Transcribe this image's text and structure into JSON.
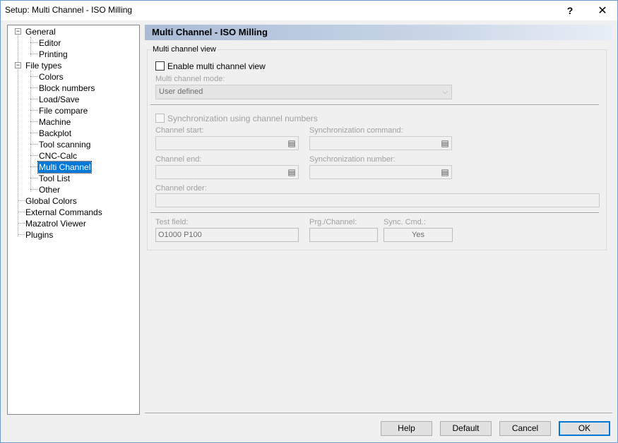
{
  "window": {
    "title": "Setup: Multi Channel - ISO Milling",
    "help_glyph": "?",
    "close_glyph": "✕"
  },
  "tree": {
    "items": [
      {
        "label": "General",
        "level": 0,
        "expander": "−"
      },
      {
        "label": "Editor",
        "level": 1
      },
      {
        "label": "Printing",
        "level": 1
      },
      {
        "label": "File types",
        "level": 0,
        "expander": "−"
      },
      {
        "label": "Colors",
        "level": 1
      },
      {
        "label": "Block numbers",
        "level": 1
      },
      {
        "label": "Load/Save",
        "level": 1
      },
      {
        "label": "File compare",
        "level": 1
      },
      {
        "label": "Machine",
        "level": 1
      },
      {
        "label": "Backplot",
        "level": 1
      },
      {
        "label": "Tool scanning",
        "level": 1
      },
      {
        "label": "CNC-Calc",
        "level": 1
      },
      {
        "label": "Multi Channel",
        "level": 1,
        "selected": true
      },
      {
        "label": "Tool List",
        "level": 1
      },
      {
        "label": "Other",
        "level": 1
      },
      {
        "label": "Global Colors",
        "level": 0
      },
      {
        "label": "External Commands",
        "level": 0
      },
      {
        "label": "Mazatrol Viewer",
        "level": 0
      },
      {
        "label": "Plugins",
        "level": 0
      }
    ]
  },
  "panel": {
    "header": "Multi Channel - ISO Milling",
    "group_label": "Multi channel view",
    "enable_label": "Enable multi channel view",
    "mode_label": "Multi channel mode:",
    "mode_value": "User defined",
    "sync_label": "Synchronization using channel numbers",
    "channel_start_label": "Channel start:",
    "sync_command_label": "Synchronization command:",
    "channel_end_label": "Channel end:",
    "sync_number_label": "Synchronization number:",
    "channel_order_label": "Channel order:",
    "test_field_label": "Test field:",
    "test_field_value": "O1000 P100",
    "prg_channel_label": "Prg./Channel:",
    "sync_cmd_label": "Sync. Cmd.:",
    "sync_cmd_value": "Yes"
  },
  "buttons": {
    "help": "Help",
    "default": "Default",
    "cancel": "Cancel",
    "ok": "OK"
  },
  "colors": {
    "selection": "#0078d7",
    "header_gradient_start": "#a9bcd6",
    "ok_border": "#0078d7"
  }
}
